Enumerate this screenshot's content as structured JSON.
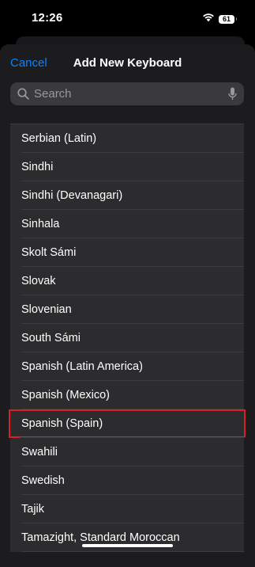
{
  "status_bar": {
    "time": "12:26",
    "battery": "61"
  },
  "nav": {
    "cancel_label": "Cancel",
    "title": "Add New Keyboard"
  },
  "search": {
    "placeholder": "Search"
  },
  "keyboards": {
    "items": [
      "Serbian (Latin)",
      "Sindhi",
      "Sindhi (Devanagari)",
      "Sinhala",
      "Skolt Sámi",
      "Slovak",
      "Slovenian",
      "South Sámi",
      "Spanish (Latin America)",
      "Spanish (Mexico)",
      "Spanish (Spain)",
      "Swahili",
      "Swedish",
      "Tajik",
      "Tamazight, Standard Moroccan"
    ],
    "highlighted_index": 10
  },
  "colors": {
    "accent": "#0a84ff",
    "highlight_box": "#d8202a",
    "sheet_background": "#1c1c1e",
    "list_background": "#2c2c2e"
  }
}
